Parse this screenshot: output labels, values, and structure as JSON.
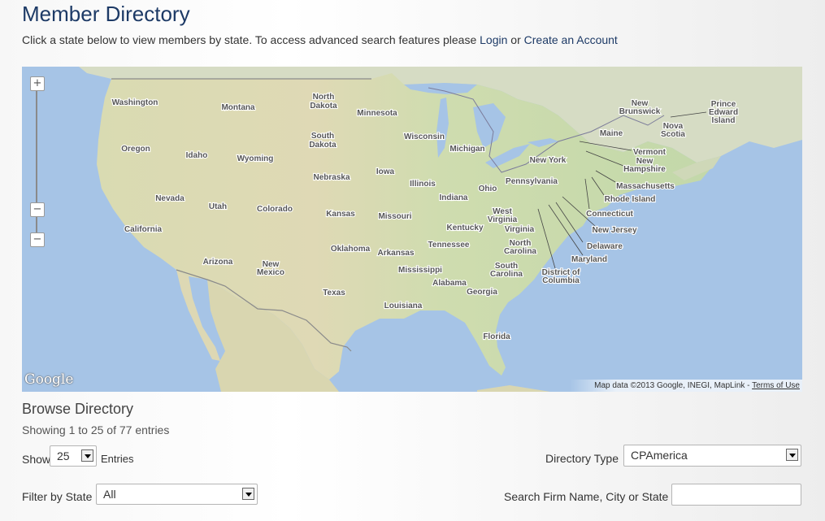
{
  "page": {
    "title": "Member Directory",
    "intro_text": "Click a state below to view members by state. To access advanced search features please ",
    "login_link": "Login",
    "or_text": " or ",
    "create_account_link": "Create an Account"
  },
  "map": {
    "zoom_in": "+",
    "zoom_out": "−",
    "zoom_handle": "−",
    "logo": "Google",
    "attribution": "Map data ©2013 Google, INEGI, MapLink - ",
    "terms_link": "Terms of Use",
    "colors": {
      "water": "#a6c4e6",
      "land_east": "#c9dcae",
      "land_west": "#ddd8b4",
      "label": "#555555"
    },
    "labels": {
      "washington": "Washington",
      "montana": "Montana",
      "north_dakota_1": "North",
      "north_dakota_2": "Dakota",
      "minnesota": "Minnesota",
      "south_dakota_1": "South",
      "south_dakota_2": "Dakota",
      "wisconsin": "Wisconsin",
      "michigan": "Michigan",
      "oregon": "Oregon",
      "idaho": "Idaho",
      "wyoming": "Wyoming",
      "nebraska": "Nebraska",
      "iowa": "Iowa",
      "illinois": "Illinois",
      "indiana": "Indiana",
      "ohio": "Ohio",
      "pennsylvania": "Pennsylvania",
      "new_york": "New York",
      "nevada": "Nevada",
      "utah": "Utah",
      "colorado": "Colorado",
      "kansas": "Kansas",
      "missouri": "Missouri",
      "kentucky": "Kentucky",
      "west_virginia_1": "West",
      "west_virginia_2": "Virginia",
      "virginia": "Virginia",
      "california": "California",
      "oklahoma": "Oklahoma",
      "arkansas": "Arkansas",
      "tennessee": "Tennessee",
      "north_carolina_1": "North",
      "north_carolina_2": "Carolina",
      "arizona": "Arizona",
      "new_mexico_1": "New",
      "new_mexico_2": "Mexico",
      "mississippi": "Mississippi",
      "alabama": "Alabama",
      "georgia": "Georgia",
      "south_carolina_1": "South",
      "south_carolina_2": "Carolina",
      "texas": "Texas",
      "louisiana": "Louisiana",
      "florida": "Florida",
      "maine": "Maine",
      "vermont": "Vermont",
      "new_hampshire_1": "New",
      "new_hampshire_2": "Hampshire",
      "massachusetts": "Massachusetts",
      "rhode_island": "Rhode Island",
      "connecticut": "Connecticut",
      "new_jersey": "New Jersey",
      "delaware": "Delaware",
      "maryland": "Maryland",
      "dc_1": "District of",
      "dc_2": "Columbia",
      "new_brunswick_1": "New",
      "new_brunswick_2": "Brunswick",
      "nova_scotia_1": "Nova",
      "nova_scotia_2": "Scotia",
      "pei_1": "Prince",
      "pei_2": "Edward",
      "pei_3": "Island"
    }
  },
  "browse": {
    "title": "Browse Directory",
    "showing": "Showing 1 to 25 of 77 entries",
    "show_label": "Show",
    "entries_value": "25",
    "entries_label": "Entries",
    "directory_type_label": "Directory Type",
    "directory_type_value": "CPAmerica",
    "filter_state_label": "Filter by State",
    "filter_state_value": "All",
    "search_label": "Search Firm Name, City or State",
    "search_value": ""
  }
}
